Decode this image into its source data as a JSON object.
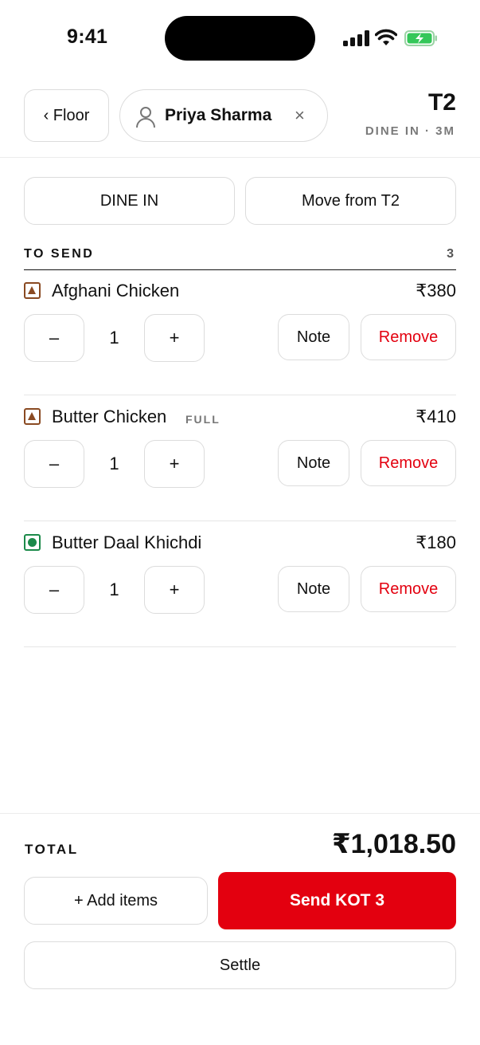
{
  "status_bar": {
    "time": "9:41",
    "icons": [
      "signal-icon",
      "wifi-icon",
      "battery-charging-icon"
    ]
  },
  "header": {
    "back_label": "‹ Floor",
    "customer_name": "Priya Sharma",
    "clear_symbol": "×",
    "table_name": "T2",
    "table_meta": "DINE IN · 3M"
  },
  "order_type": {
    "type_label": "DINE IN",
    "move_label": "Move from T2"
  },
  "section": {
    "title": "TO SEND",
    "count": "3"
  },
  "items": [
    {
      "name": "Afghani Chicken",
      "variant": "",
      "price": "₹380",
      "qty": "1",
      "diet": "non-veg"
    },
    {
      "name": "Butter Chicken",
      "variant": "FULL",
      "price": "₹410",
      "qty": "1",
      "diet": "non-veg"
    },
    {
      "name": "Butter Daal Khichdi",
      "variant": "",
      "price": "₹180",
      "qty": "1",
      "diet": "veg"
    }
  ],
  "item_actions": {
    "minus": "–",
    "plus": "+",
    "note": "Note",
    "remove": "Remove"
  },
  "footer": {
    "total_label": "TOTAL",
    "total_value": "₹1,018.50",
    "add_items_label": "+ Add items",
    "send_label": "Send KOT 3",
    "settle_label": "Settle"
  },
  "colors": {
    "accent_red": "#e3000f",
    "non_veg": "#8a4a22",
    "veg": "#1c8a4a"
  }
}
